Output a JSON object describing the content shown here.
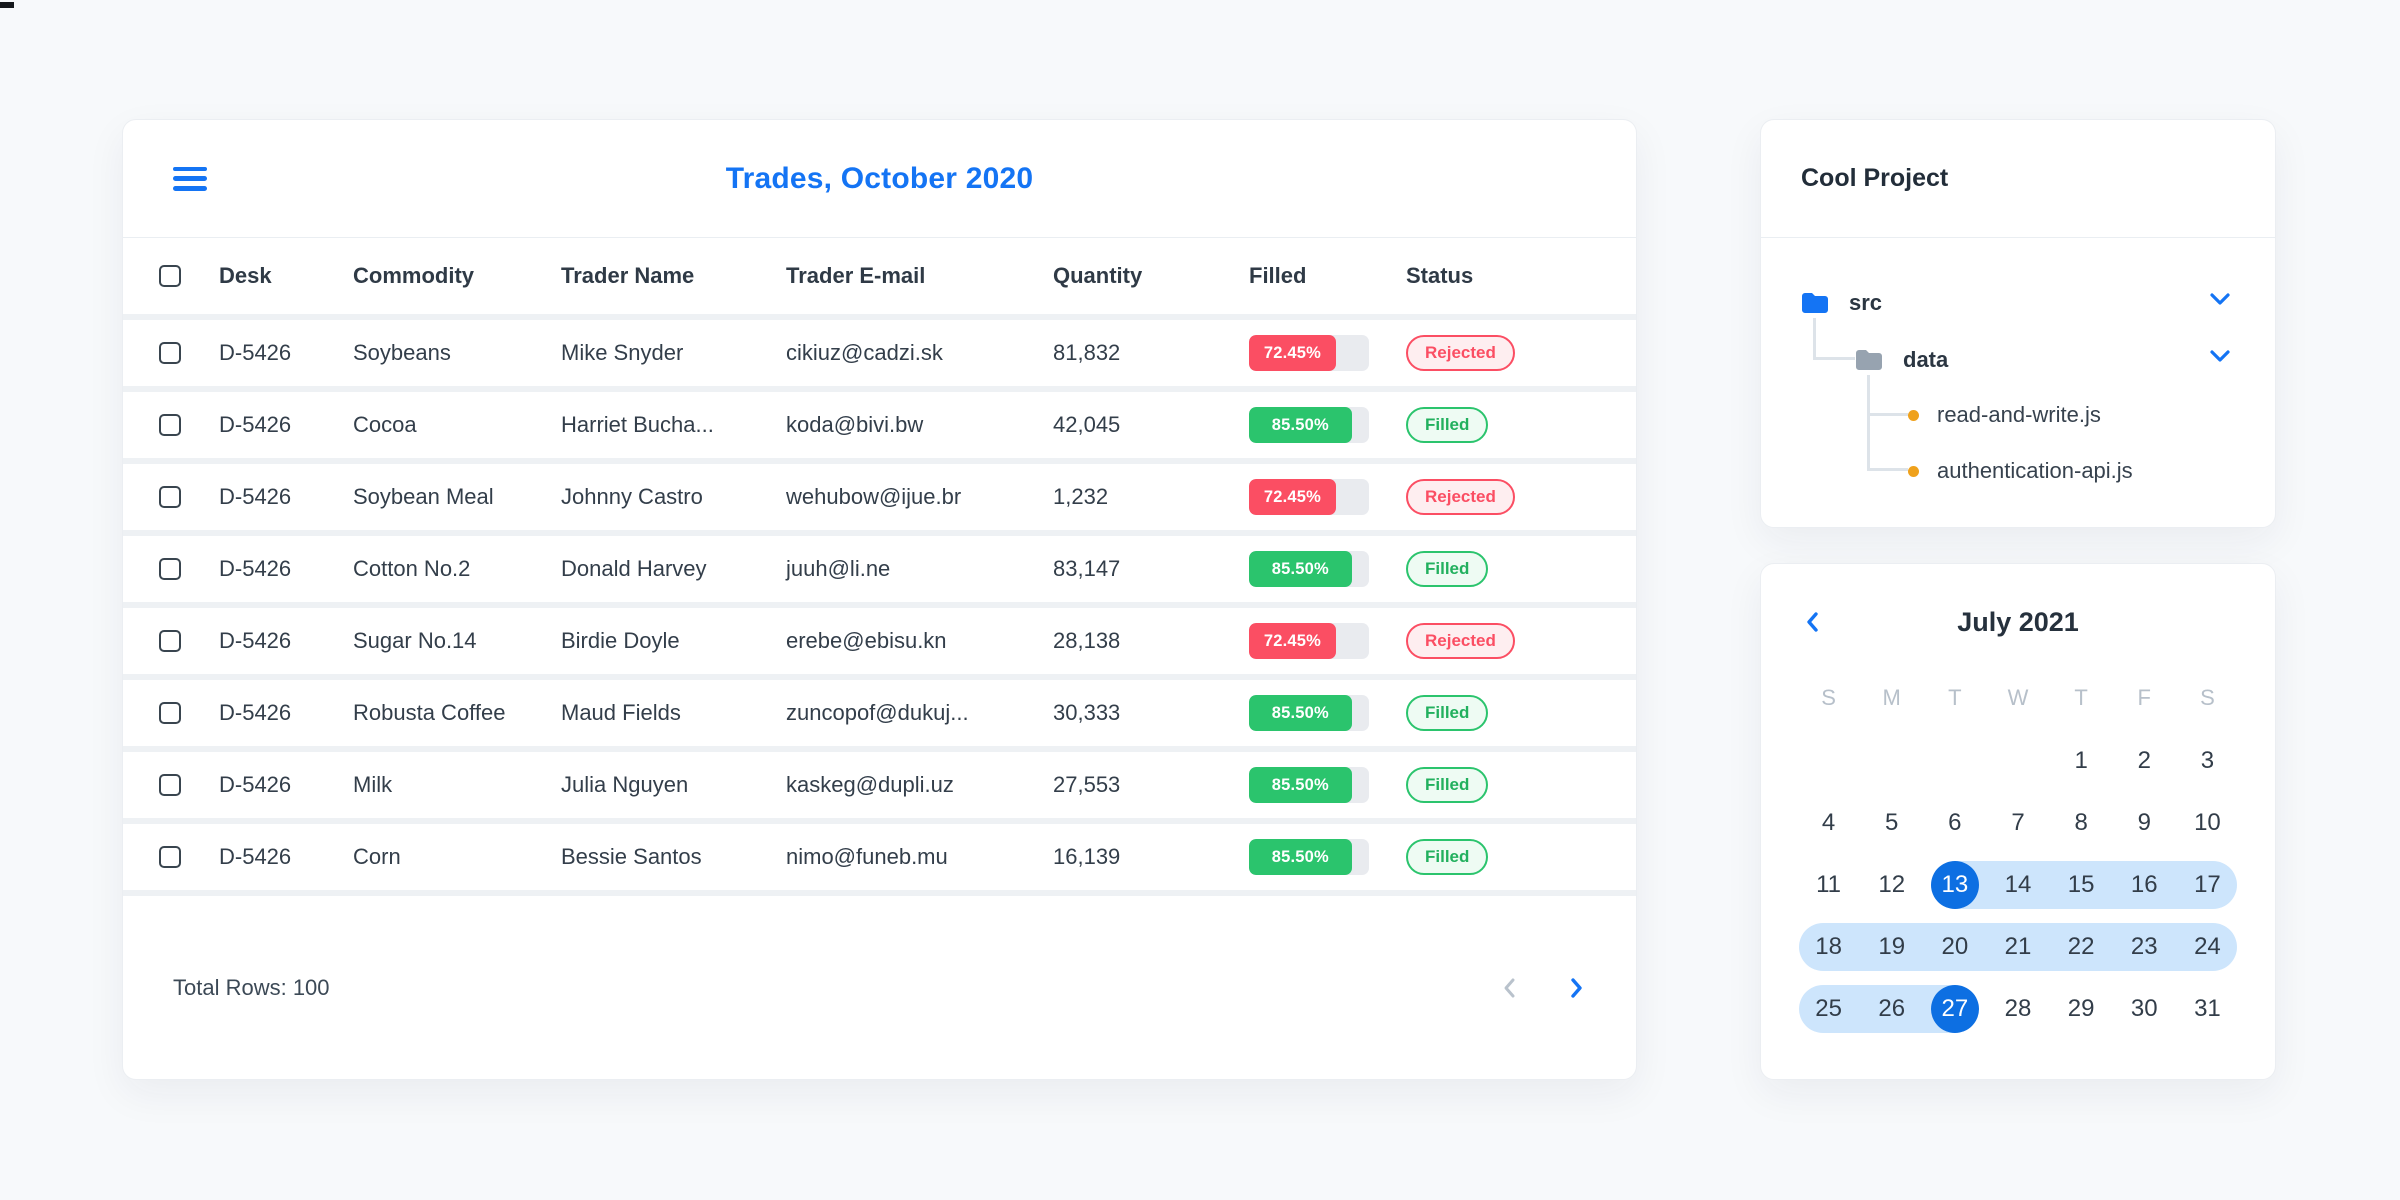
{
  "colors": {
    "accent_blue": "#1474f4",
    "selected_blue": "#0d6fe2",
    "range_blue": "#cde5fc",
    "red": "#fb4e63",
    "red_bg": "#feeef0",
    "green": "#2bc46d",
    "green_bg": "#eefbf3",
    "orange": "#efa11c",
    "gray_folder": "#97a3b0",
    "muted": "#b7c0ca"
  },
  "trades_card": {
    "title": "Trades, October 2020",
    "menu_icon": "hamburger-icon",
    "columns": [
      "Desk",
      "Commodity",
      "Trader Name",
      "Trader E-mail",
      "Quantity",
      "Filled",
      "Status"
    ],
    "rows": [
      {
        "desk": "D-5426",
        "commodity": "Soybeans",
        "trader": "Mike Snyder",
        "email": "cikiuz@cadzi.sk",
        "quantity": "81,832",
        "filled_pct": "72.45%",
        "filled_value": 72.45,
        "status": "Rejected"
      },
      {
        "desk": "D-5426",
        "commodity": "Cocoa",
        "trader": "Harriet Bucha...",
        "email": "koda@bivi.bw",
        "quantity": "42,045",
        "filled_pct": "85.50%",
        "filled_value": 85.5,
        "status": "Filled"
      },
      {
        "desk": "D-5426",
        "commodity": "Soybean Meal",
        "trader": "Johnny Castro",
        "email": "wehubow@ijue.br",
        "quantity": "1,232",
        "filled_pct": "72.45%",
        "filled_value": 72.45,
        "status": "Rejected"
      },
      {
        "desk": "D-5426",
        "commodity": "Cotton No.2",
        "trader": "Donald Harvey",
        "email": "juuh@li.ne",
        "quantity": "83,147",
        "filled_pct": "85.50%",
        "filled_value": 85.5,
        "status": "Filled"
      },
      {
        "desk": "D-5426",
        "commodity": "Sugar No.14",
        "trader": "Birdie Doyle",
        "email": "erebe@ebisu.kn",
        "quantity": "28,138",
        "filled_pct": "72.45%",
        "filled_value": 72.45,
        "status": "Rejected"
      },
      {
        "desk": "D-5426",
        "commodity": "Robusta Coffee",
        "trader": "Maud Fields",
        "email": "zuncopof@dukuj...",
        "quantity": "30,333",
        "filled_pct": "85.50%",
        "filled_value": 85.5,
        "status": "Filled"
      },
      {
        "desk": "D-5426",
        "commodity": "Milk",
        "trader": "Julia Nguyen",
        "email": "kaskeg@dupli.uz",
        "quantity": "27,553",
        "filled_pct": "85.50%",
        "filled_value": 85.5,
        "status": "Filled"
      },
      {
        "desk": "D-5426",
        "commodity": "Corn",
        "trader": "Bessie Santos",
        "email": "nimo@funeb.mu",
        "quantity": "16,139",
        "filled_pct": "85.50%",
        "filled_value": 85.5,
        "status": "Filled"
      }
    ],
    "footer": {
      "total_label": "Total Rows: 100",
      "prev_icon": "chevron-left-icon",
      "next_icon": "chevron-right-icon"
    }
  },
  "project_card": {
    "title": "Cool Project",
    "tree": [
      {
        "label": "src",
        "type": "folder",
        "icon": "folder-blue-icon",
        "chevron": "chevron-down-icon"
      },
      {
        "label": "data",
        "type": "folder",
        "icon": "folder-gray-icon",
        "chevron": "chevron-down-icon"
      },
      {
        "label": "read-and-write.js",
        "type": "file",
        "icon": "orange-dot-icon"
      },
      {
        "label": "authentication-api.js",
        "type": "file",
        "icon": "orange-dot-icon"
      }
    ]
  },
  "calendar_card": {
    "title": "July 2021",
    "prev_icon": "chevron-left-icon",
    "day_headers": [
      "S",
      "M",
      "T",
      "W",
      "T",
      "F",
      "S"
    ],
    "selected_range": {
      "start_day": "13",
      "end_day": "27"
    },
    "weeks": [
      [
        {
          "d": ""
        },
        {
          "d": ""
        },
        {
          "d": ""
        },
        {
          "d": ""
        },
        {
          "d": "1"
        },
        {
          "d": "2"
        },
        {
          "d": "3"
        }
      ],
      [
        {
          "d": "4"
        },
        {
          "d": "5"
        },
        {
          "d": "6"
        },
        {
          "d": "7"
        },
        {
          "d": "8"
        },
        {
          "d": "9"
        },
        {
          "d": "10"
        }
      ],
      [
        {
          "d": "11"
        },
        {
          "d": "12"
        },
        {
          "d": "13",
          "sel": true,
          "band": "half-right"
        },
        {
          "d": "14",
          "band": "mid"
        },
        {
          "d": "15",
          "band": "mid"
        },
        {
          "d": "16",
          "band": "mid"
        },
        {
          "d": "17",
          "band": "cap-right"
        }
      ],
      [
        {
          "d": "18",
          "band": "cap-left"
        },
        {
          "d": "19",
          "band": "mid"
        },
        {
          "d": "20",
          "band": "mid"
        },
        {
          "d": "21",
          "band": "mid"
        },
        {
          "d": "22",
          "band": "mid"
        },
        {
          "d": "23",
          "band": "mid"
        },
        {
          "d": "24",
          "band": "cap-right"
        }
      ],
      [
        {
          "d": "25",
          "band": "cap-left"
        },
        {
          "d": "26",
          "band": "mid"
        },
        {
          "d": "27",
          "sel": true,
          "band": "half-left"
        },
        {
          "d": "28"
        },
        {
          "d": "29"
        },
        {
          "d": "30"
        },
        {
          "d": "31"
        }
      ]
    ]
  }
}
